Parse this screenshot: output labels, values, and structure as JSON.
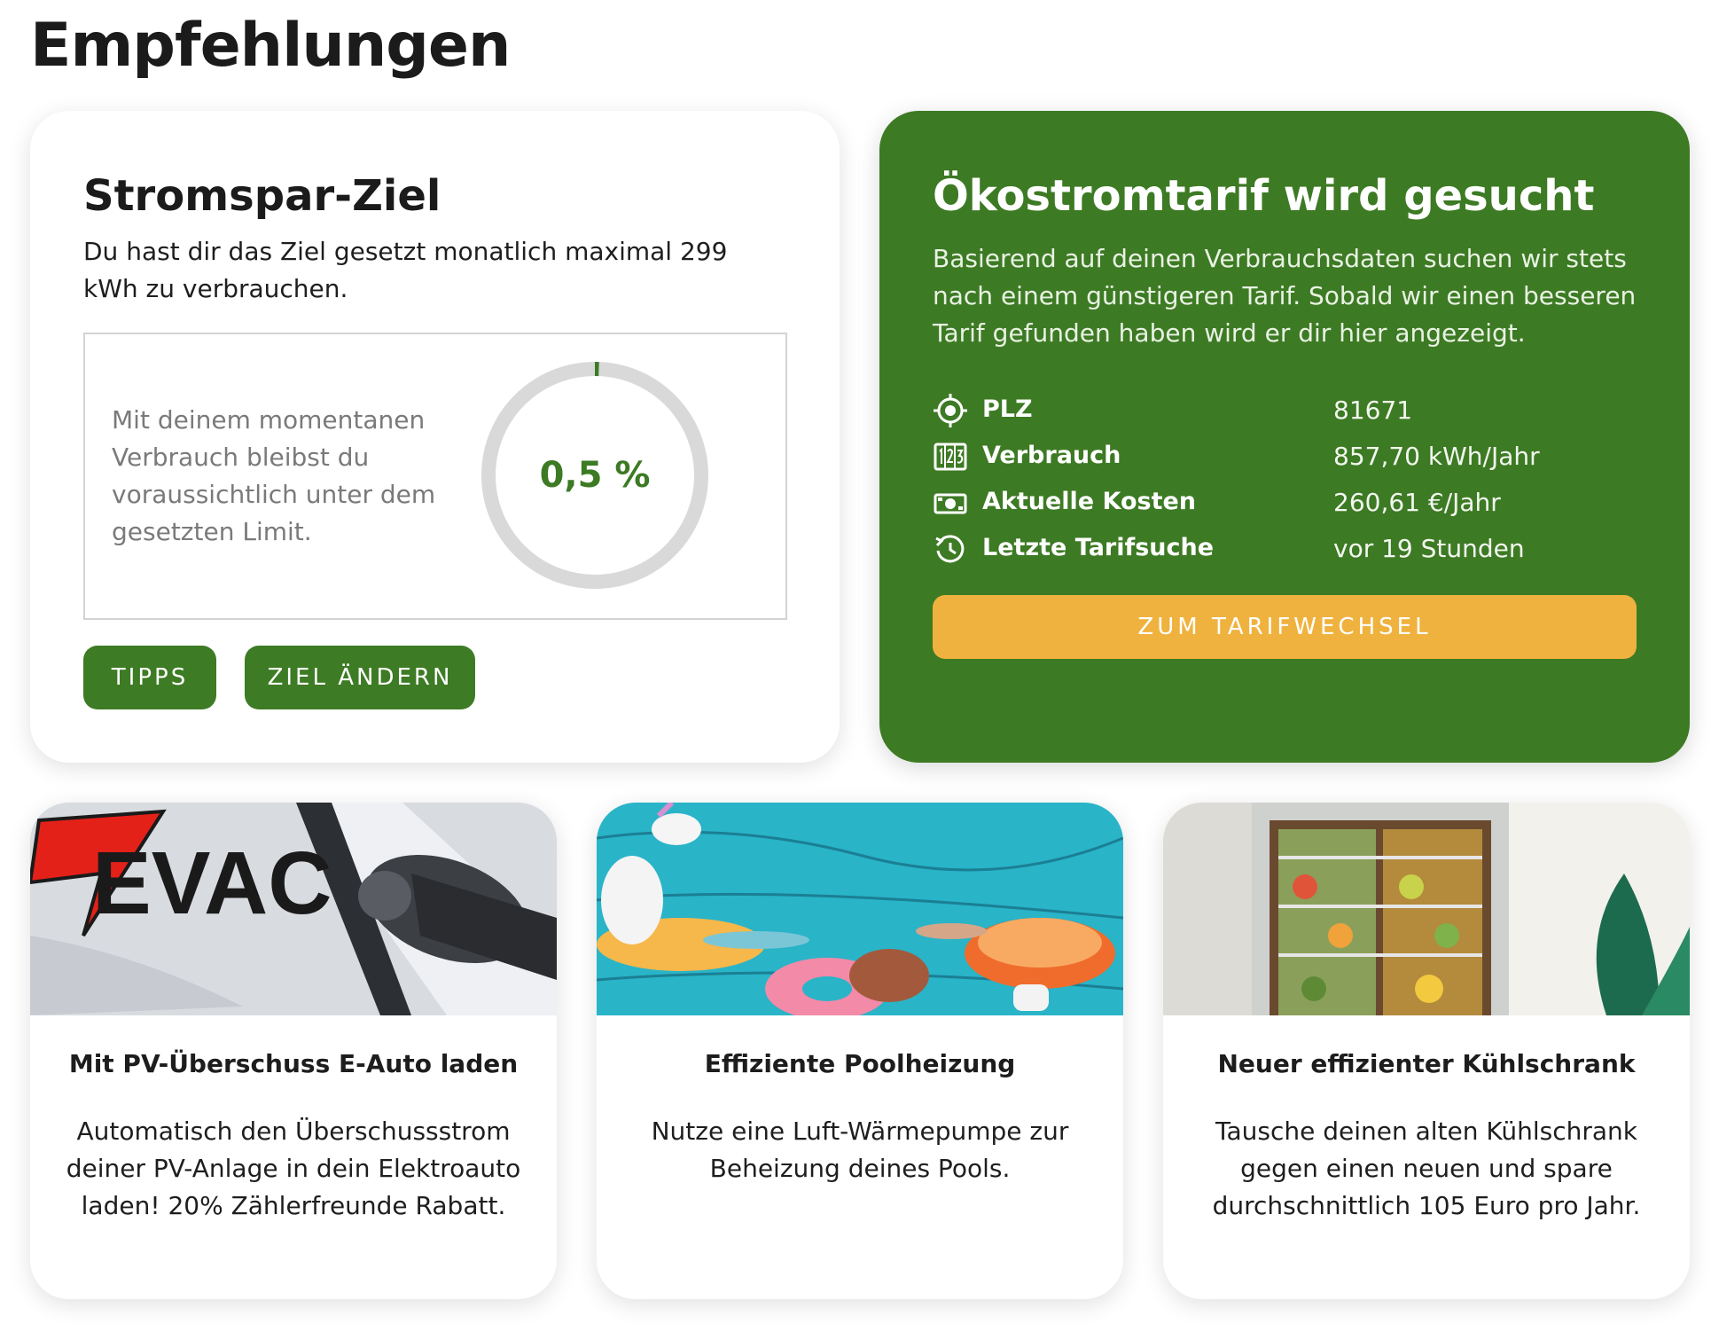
{
  "page": {
    "title": "Empfehlungen"
  },
  "goal": {
    "title": "Stromspar-Ziel",
    "description": "Du hast dir das Ziel gesetzt monatlich maximal 299 kWh zu verbrauchen.",
    "forecast_text": "Mit deinem momentanen Verbrauch bleibst du voraussichtlich unter dem gesetzten Limit.",
    "progress_label": "0,5 %",
    "progress_fraction": 0.005,
    "tips_label": "TIPPS",
    "change_goal_label": "ZIEL ÄNDERN"
  },
  "tariff": {
    "title": "Ökostromtarif wird gesucht",
    "description": "Basierend auf deinen Verbrauchsdaten suchen wir stets nach einem günstigeren Tarif. Sobald wir einen besseren Tarif gefunden haben wird er dir hier angezeigt.",
    "facts": [
      {
        "icon": "target-icon",
        "label": "PLZ",
        "value": "81671"
      },
      {
        "icon": "meter-icon",
        "label": "Verbrauch",
        "value": "857,70 kWh/Jahr"
      },
      {
        "icon": "banknote-icon",
        "label": "Aktuelle Kosten",
        "value": "260,61 €/Jahr"
      },
      {
        "icon": "history-icon",
        "label": "Letzte Tarifsuche",
        "value": "vor 19 Stunden"
      }
    ],
    "button_label": "ZUM TARIFWECHSEL"
  },
  "recommendations": [
    {
      "title": "Mit PV-Überschuss E-Auto laden",
      "description": "Automatisch den Überschussstrom deiner PV-Anlage in dein Elektroauto laden! 20% Zählerfreunde Rabatt.",
      "image_logo": "EVAC"
    },
    {
      "title": "Effiziente Poolheizung",
      "description": "Nutze eine Luft-Wärmepumpe zur Beheizung deines Pools."
    },
    {
      "title": "Neuer effizienter Kühlschrank",
      "description": "Tausche deinen alten Kühlschrank gegen einen neuen und spare durchschnittlich 105 Euro pro Jahr."
    }
  ],
  "colors": {
    "brand_green": "#3d7b24",
    "accent_orange": "#f0b23e",
    "ring_gray": "#d9d9d9"
  }
}
